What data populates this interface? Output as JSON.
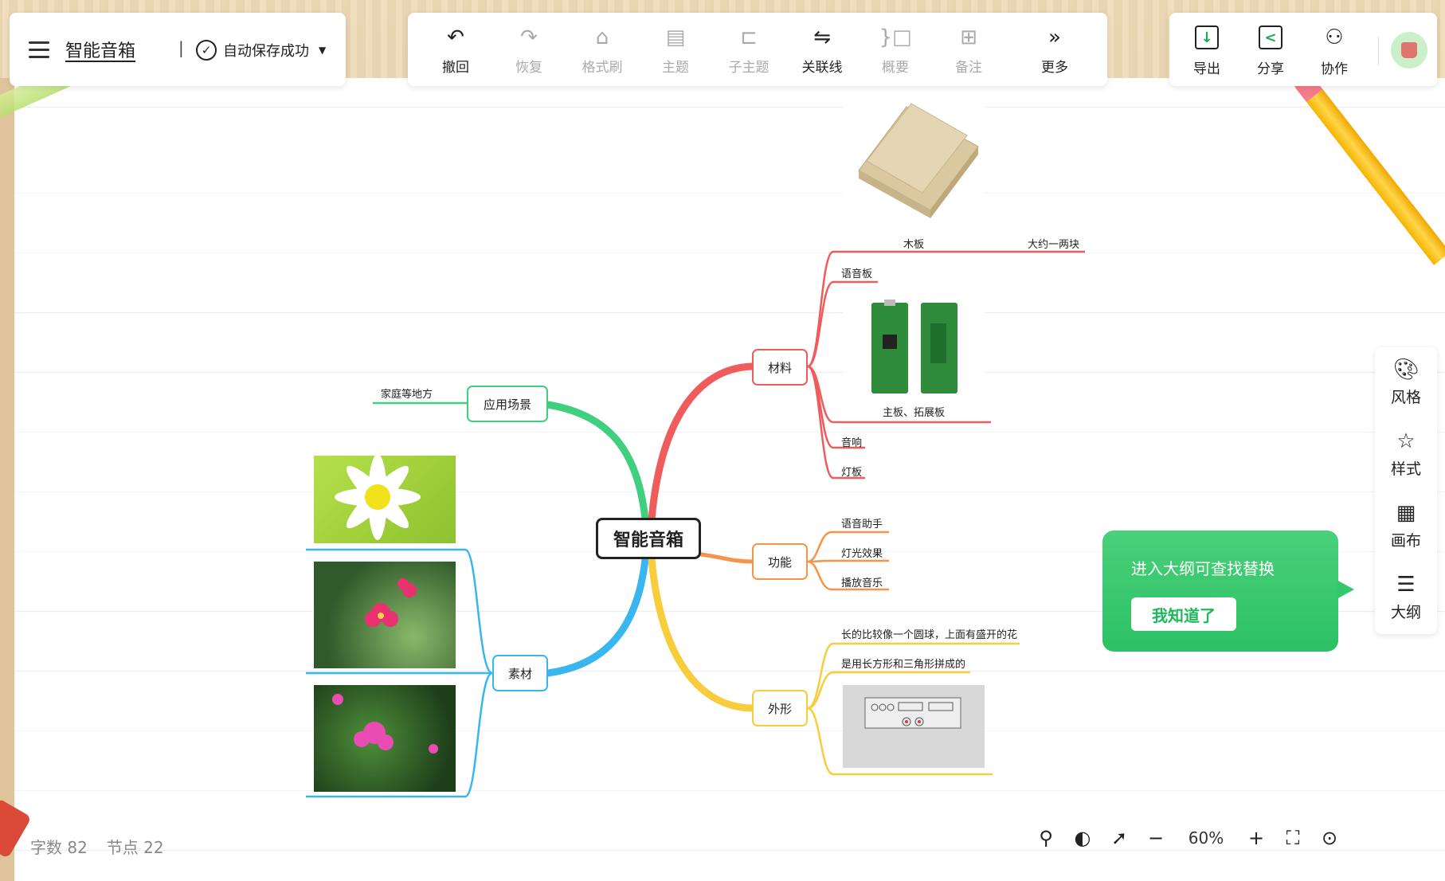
{
  "header": {
    "doc_title": "智能音箱",
    "separator": "|",
    "save_status": "自动保存成功"
  },
  "toolbar": {
    "undo": "撤回",
    "redo": "恢复",
    "format_brush": "格式刷",
    "topic": "主题",
    "subtopic": "子主题",
    "relation": "关联线",
    "summary": "概要",
    "note": "备注",
    "more": "更多"
  },
  "right_toolbar": {
    "export": "导出",
    "share": "分享",
    "collab": "协作"
  },
  "side_panel": {
    "style": "风格",
    "format": "样式",
    "canvas": "画布",
    "outline": "大纲"
  },
  "tooltip": {
    "text": "进入大纲可查找替换",
    "button": "我知道了"
  },
  "stats": {
    "words": "字数 82",
    "nodes": "节点 22"
  },
  "zoom": {
    "level": "60%",
    "minus": "−",
    "plus": "+"
  },
  "mindmap": {
    "root": "智能音箱",
    "branches": {
      "scenario": {
        "label": "应用场景",
        "color": "#3ecf7f",
        "leaves": [
          "家庭等地方"
        ]
      },
      "materials_assets": {
        "label": "素材",
        "color": "#39b6f0"
      },
      "materials": {
        "label": "材料",
        "color": "#f05b5b",
        "leaves": [
          "木板",
          "大约一两块",
          "语音板",
          "主板、拓展板",
          "音响",
          "灯板"
        ]
      },
      "function": {
        "label": "功能",
        "color": "#f6944a",
        "leaves": [
          "语音助手",
          "灯光效果",
          "播放音乐"
        ]
      },
      "shape": {
        "label": "外形",
        "color": "#f7cd3c",
        "leaves": [
          "长的比较像一个圆球，上面有盛开的花",
          "是用长方形和三角形拼成的"
        ]
      }
    }
  },
  "colors": {
    "accent_green": "#2cc164",
    "wood": "#e9d3ad"
  }
}
